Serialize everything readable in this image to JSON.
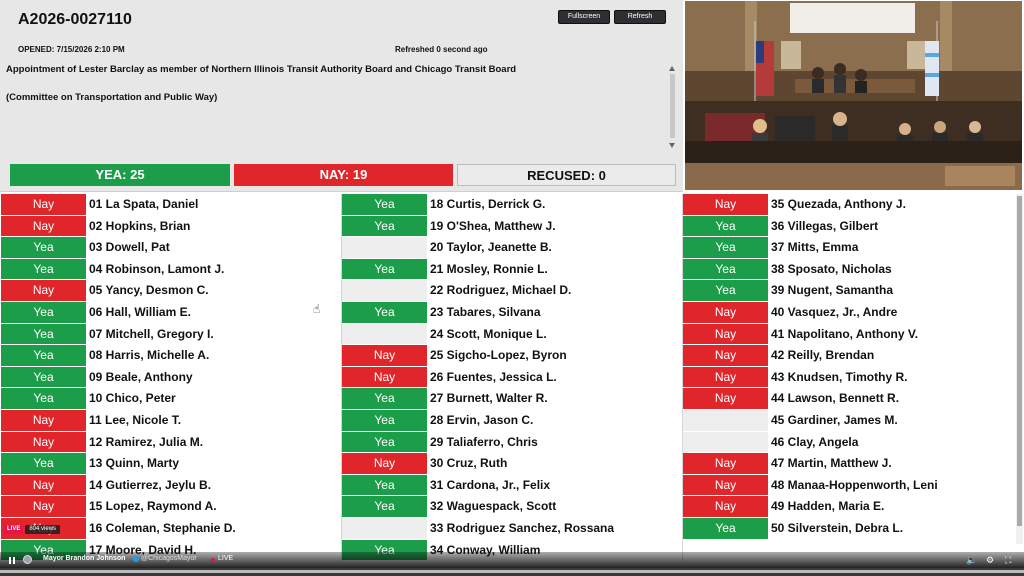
{
  "header": {
    "matter_id": "A2026-0027110",
    "opened": "OPENED: 7/15/2026 2:10 PM",
    "refreshed": "Refreshed 0 second ago",
    "fullscreen_label": "Fullscreen",
    "refresh_label": "Refresh",
    "description": "Appointment of Lester Barclay as member of Northern Illinois Transit Authority Board and Chicago Transit Board",
    "committee": "(Committee on Transportation and Public Way)"
  },
  "tally": {
    "yea": "YEA: 25",
    "nay": "NAY: 19",
    "recused": "RECUSED: 0"
  },
  "colors": {
    "yea": "#1b9d49",
    "nay": "#e0262a",
    "none": "#eeeeee"
  },
  "vote_labels": {
    "yea": "Yea",
    "nay": "Nay",
    "none": ""
  },
  "roll_call": [
    [
      {
        "name": "01 La Spata, Daniel",
        "vote": "nay"
      },
      {
        "name": "02 Hopkins, Brian",
        "vote": "nay"
      },
      {
        "name": "03 Dowell, Pat",
        "vote": "yea"
      },
      {
        "name": "04 Robinson, Lamont J.",
        "vote": "yea"
      },
      {
        "name": "05 Yancy, Desmon C.",
        "vote": "nay"
      },
      {
        "name": "06 Hall, William E.",
        "vote": "yea"
      },
      {
        "name": "07 Mitchell, Gregory I.",
        "vote": "yea"
      },
      {
        "name": "08 Harris, Michelle A.",
        "vote": "yea"
      },
      {
        "name": "09 Beale, Anthony",
        "vote": "yea"
      },
      {
        "name": "10 Chico, Peter",
        "vote": "yea"
      },
      {
        "name": "11 Lee, Nicole T.",
        "vote": "nay"
      },
      {
        "name": "12 Ramirez, Julia M.",
        "vote": "nay"
      },
      {
        "name": "13 Quinn, Marty",
        "vote": "yea"
      },
      {
        "name": "14 Gutierrez, Jeylu B.",
        "vote": "nay"
      },
      {
        "name": "15 Lopez, Raymond A.",
        "vote": "nay"
      },
      {
        "name": "16 Coleman, Stephanie D.",
        "vote": "nay"
      },
      {
        "name": "17 Moore, David H.",
        "vote": "yea"
      }
    ],
    [
      {
        "name": "18 Curtis, Derrick G.",
        "vote": "yea"
      },
      {
        "name": "19 O'Shea, Matthew J.",
        "vote": "yea"
      },
      {
        "name": "20 Taylor, Jeanette B.",
        "vote": "none"
      },
      {
        "name": "21 Mosley, Ronnie L.",
        "vote": "yea"
      },
      {
        "name": "22 Rodriguez, Michael D.",
        "vote": "none"
      },
      {
        "name": "23 Tabares, Silvana",
        "vote": "yea"
      },
      {
        "name": "24 Scott, Monique L.",
        "vote": "none"
      },
      {
        "name": "25 Sigcho-Lopez, Byron",
        "vote": "nay"
      },
      {
        "name": "26 Fuentes, Jessica L.",
        "vote": "nay"
      },
      {
        "name": "27 Burnett, Walter R.",
        "vote": "yea"
      },
      {
        "name": "28 Ervin, Jason C.",
        "vote": "yea"
      },
      {
        "name": "29 Taliaferro, Chris",
        "vote": "yea"
      },
      {
        "name": "30 Cruz, Ruth",
        "vote": "nay"
      },
      {
        "name": "31 Cardona, Jr., Felix",
        "vote": "yea"
      },
      {
        "name": "32 Waguespack, Scott",
        "vote": "yea"
      },
      {
        "name": "33 Rodriguez Sanchez, Rossana",
        "vote": "none"
      },
      {
        "name": "34 Conway, William",
        "vote": "yea"
      }
    ],
    [
      {
        "name": "35 Quezada, Anthony J.",
        "vote": "nay"
      },
      {
        "name": "36 Villegas, Gilbert",
        "vote": "yea"
      },
      {
        "name": "37 Mitts, Emma",
        "vote": "yea"
      },
      {
        "name": "38 Sposato, Nicholas",
        "vote": "yea"
      },
      {
        "name": "39 Nugent, Samantha",
        "vote": "yea"
      },
      {
        "name": "40 Vasquez, Jr., Andre",
        "vote": "nay"
      },
      {
        "name": "41 Napolitano, Anthony V.",
        "vote": "nay"
      },
      {
        "name": "42 Reilly, Brendan",
        "vote": "nay"
      },
      {
        "name": "43 Knudsen, Timothy R.",
        "vote": "nay"
      },
      {
        "name": "44 Lawson, Bennett R.",
        "vote": "nay"
      },
      {
        "name": "45 Gardiner, James M.",
        "vote": "none"
      },
      {
        "name": "46 Clay, Angela",
        "vote": "none"
      },
      {
        "name": "47 Martin, Matthew J.",
        "vote": "nay"
      },
      {
        "name": "48 Manaa-Hoppenworth, Leni",
        "vote": "nay"
      },
      {
        "name": "49 Hadden, Maria E.",
        "vote": "nay"
      },
      {
        "name": "50 Silverstein, Debra L.",
        "vote": "yea"
      }
    ]
  ],
  "player": {
    "live_badge": "LIVE",
    "views": "804 views",
    "channel": "Mayor Brandon Johnson",
    "handle": "@ChicagosMayor",
    "live_label": "LIVE",
    "progress": 1.0,
    "icons": {
      "pause": "pause-icon",
      "volume": "volume-icon",
      "settings": "gear-icon",
      "fullscreen": "fullscreen-icon"
    }
  }
}
